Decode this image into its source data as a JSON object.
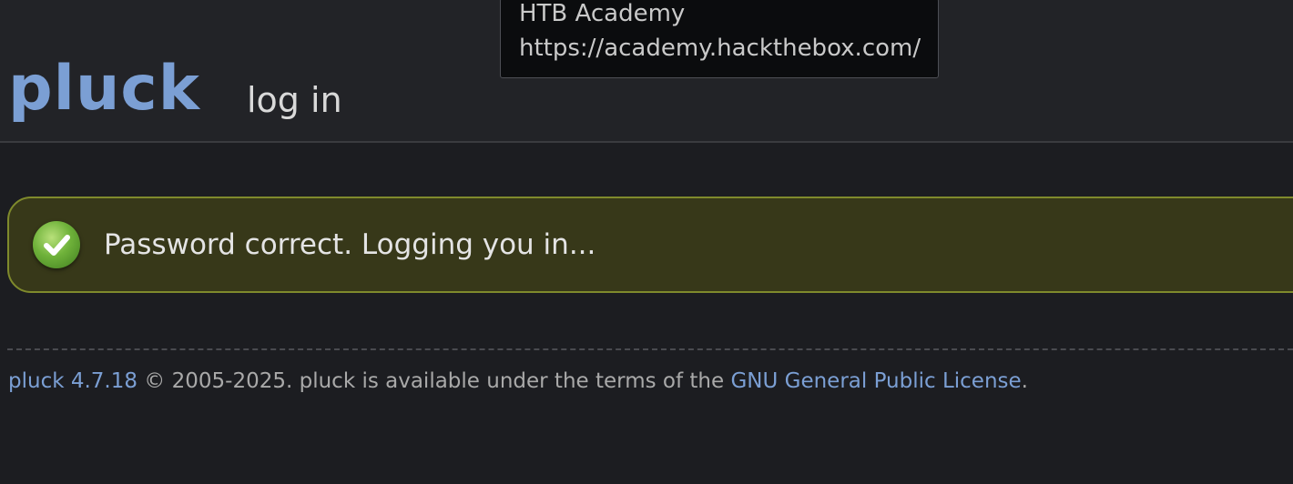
{
  "tooltip": {
    "title": "HTB Academy",
    "url": "https://academy.hackthebox.com/"
  },
  "header": {
    "logo": "pluck",
    "title": "log in"
  },
  "message": {
    "text": "Password correct. Logging you in...",
    "icon": "check-icon",
    "color": "#373819"
  },
  "footer": {
    "version_link": "pluck 4.7.18",
    "text": " © 2005-2025. pluck is available under the terms of the ",
    "license_link": "GNU General Public License",
    "period": "."
  },
  "colors": {
    "accent": "#7b9fd4",
    "background": "#1c1d21",
    "success_border": "#7f8a2c"
  }
}
